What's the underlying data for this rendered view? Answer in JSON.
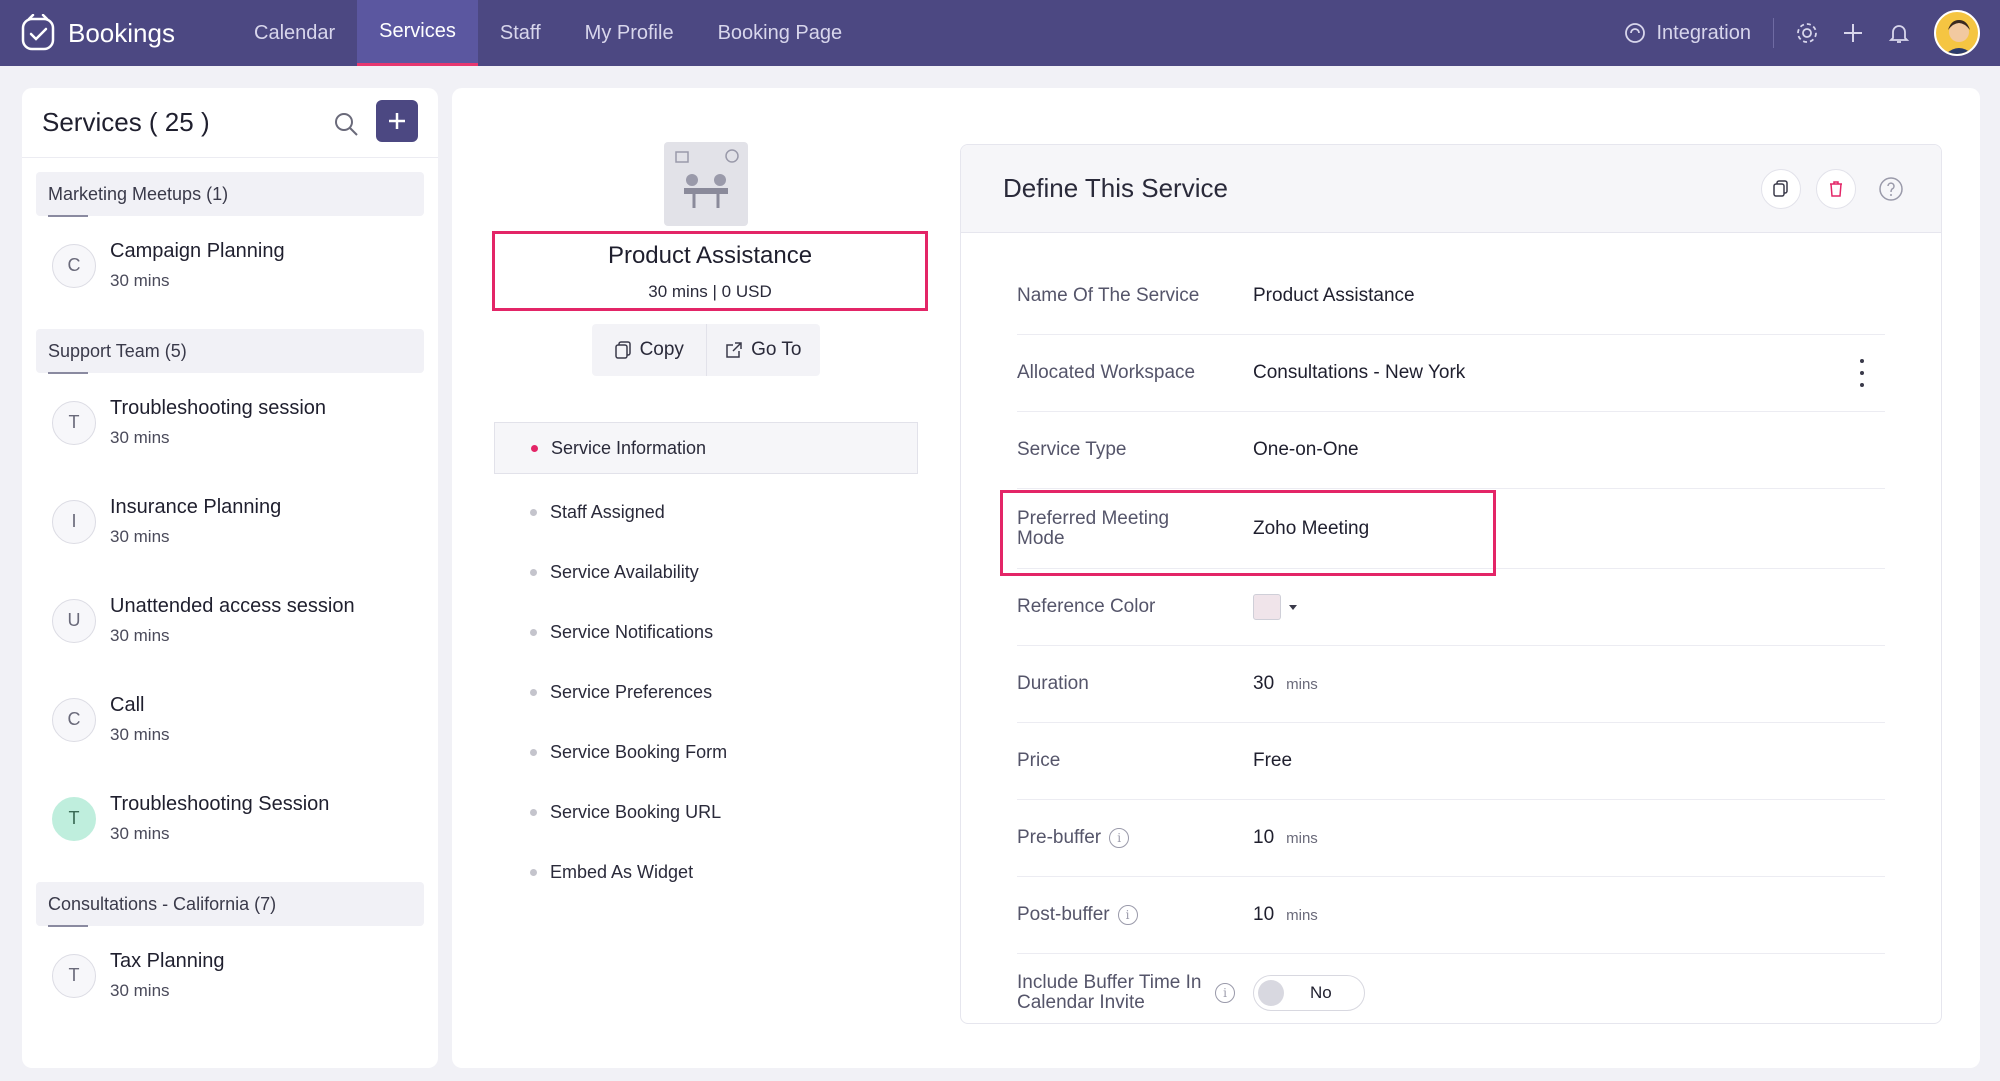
{
  "app": {
    "name": "Bookings"
  },
  "nav": {
    "tabs": [
      "Calendar",
      "Services",
      "Staff",
      "My Profile",
      "Booking Page"
    ],
    "active": "Services",
    "integration_label": "Integration"
  },
  "sidebar": {
    "title": "Services ( 25 )",
    "groups": [
      {
        "name": "Marketing Meetups (1)",
        "items": [
          {
            "initial": "C",
            "title": "Campaign Planning",
            "duration": "30 mins"
          }
        ]
      },
      {
        "name": "Support Team (5)",
        "items": [
          {
            "initial": "T",
            "title": "Troubleshooting session",
            "duration": "30 mins"
          },
          {
            "initial": "I",
            "title": "Insurance Planning",
            "duration": "30 mins"
          },
          {
            "initial": "U",
            "title": "Unattended access session",
            "duration": "30 mins"
          },
          {
            "initial": "C",
            "title": "Call",
            "duration": "30 mins"
          },
          {
            "initial": "T",
            "title": "Troubleshooting Session",
            "duration": "30 mins"
          }
        ]
      },
      {
        "name": "Consultations - California (7)",
        "items": [
          {
            "initial": "T",
            "title": "Tax Planning",
            "duration": "30 mins"
          }
        ]
      }
    ]
  },
  "service": {
    "title": "Product Assistance",
    "subtitle": "30 mins | 0 USD",
    "copy_label": "Copy",
    "goto_label": "Go To"
  },
  "menu": [
    "Service Information",
    "Staff Assigned",
    "Service Availability",
    "Service Notifications",
    "Service Preferences",
    "Service Booking Form",
    "Service Booking URL",
    "Embed As Widget"
  ],
  "define": {
    "title": "Define This Service",
    "rows": {
      "name": {
        "label": "Name Of The Service",
        "value": "Product Assistance"
      },
      "workspace": {
        "label": "Allocated Workspace",
        "value": "Consultations - New York"
      },
      "type": {
        "label": "Service Type",
        "value": "One-on-One"
      },
      "mode": {
        "label": "Preferred Meeting Mode",
        "value": "Zoho Meeting"
      },
      "color": {
        "label": "Reference Color",
        "value": "#f0e4ea"
      },
      "duration": {
        "label": "Duration",
        "value": "30",
        "unit": "mins"
      },
      "price": {
        "label": "Price",
        "value": "Free"
      },
      "prebuffer": {
        "label": "Pre-buffer",
        "value": "10",
        "unit": "mins"
      },
      "postbuffer": {
        "label": "Post-buffer",
        "value": "10",
        "unit": "mins"
      },
      "include": {
        "label": "Include Buffer Time In Calendar Invite",
        "value": "No"
      }
    }
  },
  "colors": {
    "topbar": "#4c4882",
    "accent": "#e32567"
  }
}
